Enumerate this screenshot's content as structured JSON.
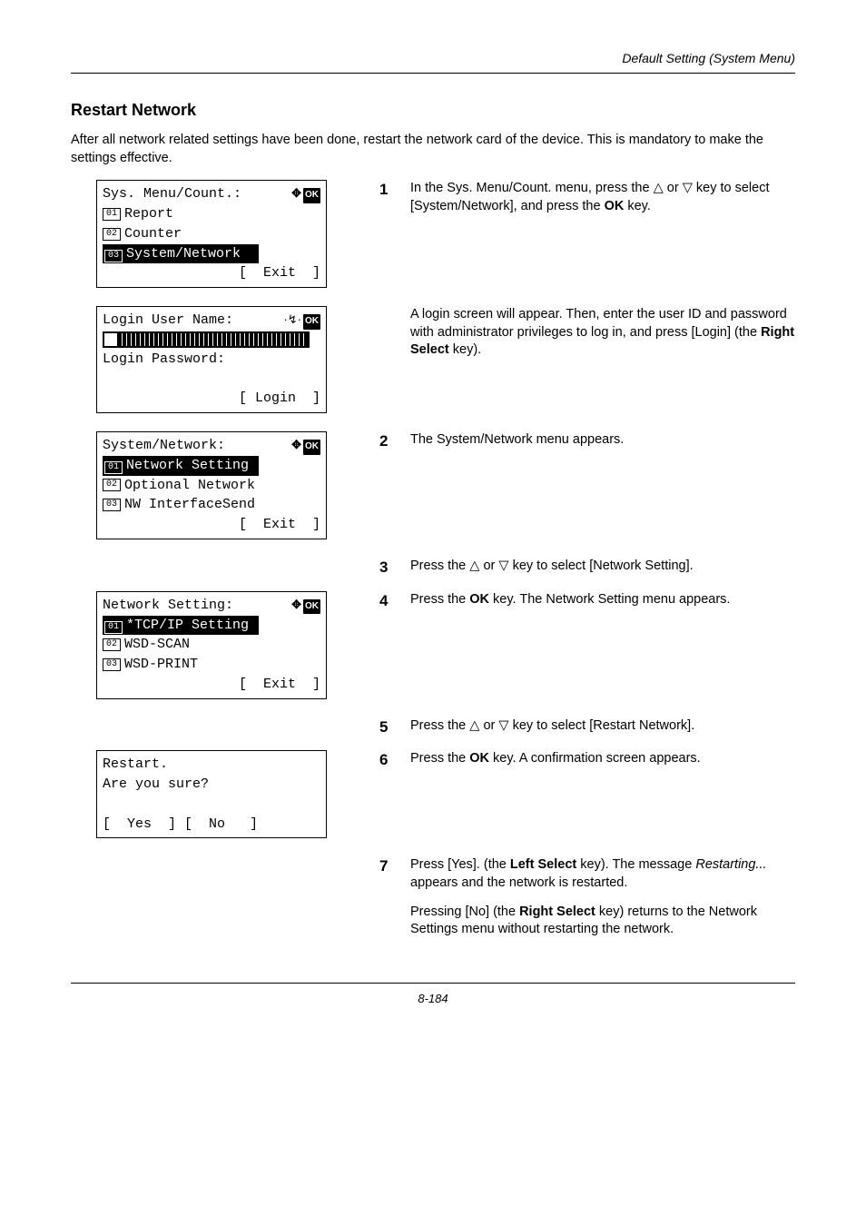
{
  "running_head": "Default Setting (System Menu)",
  "heading": "Restart Network",
  "intro": "After all network related settings have been done, restart the network card of the device. This is mandatory to make the settings effective.",
  "lcd1": {
    "title": "Sys. Menu/Count.:",
    "item1_num": "01",
    "item1_label": "Report",
    "item2_num": "02",
    "item2_label": "Counter",
    "item3_num": "03",
    "item3_label": "System/Network",
    "softkey": "[  Exit  ]"
  },
  "lcd2": {
    "line1": "Login User Name:",
    "line3": "Login Password:",
    "softkey": "[ Login  ]"
  },
  "lcd3": {
    "title": "System/Network:",
    "item1_num": "01",
    "item1_label": "Network Setting",
    "item2_num": "02",
    "item2_label": "Optional Network",
    "item3_num": "03",
    "item3_label": "NW InterfaceSend",
    "softkey": "[  Exit  ]"
  },
  "lcd4": {
    "title": "Network Setting:",
    "item1_num": "01",
    "item1_label": "*TCP/IP Setting",
    "item2_num": "02",
    "item2_label": "WSD-SCAN",
    "item3_num": "03",
    "item3_label": "WSD-PRINT",
    "softkey": "[  Exit  ]"
  },
  "lcd5": {
    "line1": "Restart.",
    "line2": "Are you sure?",
    "softkeys": "[  Yes  ] [  No   ]"
  },
  "steps": {
    "s1_a": "In the Sys. Menu/Count. menu, press the ",
    "s1_b": " or ",
    "s1_c": " key to select [System/Network], and press the ",
    "s1_ok": "OK",
    "s1_d": " key.",
    "s1_p2_a": "A login screen will appear. Then, enter the user ID and password with administrator privileges to log in, and press [Login] (the ",
    "s1_p2_rs": "Right Select",
    "s1_p2_b": " key).",
    "s2": "The System/Network menu appears.",
    "s3_a": "Press the ",
    "s3_b": " or ",
    "s3_c": " key to select [Network Setting].",
    "s4_a": "Press the ",
    "s4_ok": "OK",
    "s4_b": " key. The Network Setting menu appears.",
    "s5_a": "Press the ",
    "s5_b": " or ",
    "s5_c": " key to select [Restart Network].",
    "s6_a": "Press the ",
    "s6_ok": "OK",
    "s6_b": " key. A confirmation screen appears.",
    "s7_a": "Press [Yes]. (the ",
    "s7_ls": "Left Select",
    "s7_b": " key). The message ",
    "s7_it": "Restarting...",
    "s7_c": " appears and the network is restarted.",
    "s7_p2_a": "Pressing [No] (the ",
    "s7_p2_rs": "Right Select",
    "s7_p2_b": " key) returns to the Network Settings menu without restarting the network."
  },
  "page_num": "8-184",
  "nums": {
    "n1": "1",
    "n2": "2",
    "n3": "3",
    "n4": "4",
    "n5": "5",
    "n6": "6",
    "n7": "7"
  },
  "glyph": {
    "ok": "OK",
    "up": "△",
    "down": "▽",
    "arrows": "✥",
    "cursor": "·↯·"
  }
}
